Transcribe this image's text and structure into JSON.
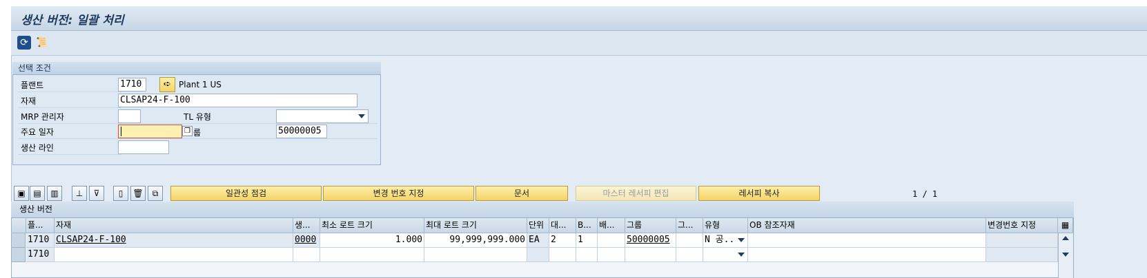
{
  "window": {
    "title": "생산 버전: 일괄 처리"
  },
  "toolbar": {
    "icons": [
      "refresh-icon",
      "scroll-icon"
    ]
  },
  "selection": {
    "title": "선택 조건",
    "plant_label": "플랜트",
    "plant_value": "1710",
    "plant_name": "Plant 1 US",
    "material_label": "자재",
    "material_value": "CLSAP24-F-100",
    "mrp_label": "MRP 관리자",
    "mrp_value": "",
    "tl_type_label": "TL 유형",
    "tl_type_value": "",
    "key_date_label": "주요 일자",
    "key_date_value": "",
    "group_label_partial": "룹",
    "group_value": "50000005",
    "prod_line_label": "생산 라인",
    "prod_line_value": ""
  },
  "grid_toolbar": {
    "buttons": [
      "일관성 점검",
      "변경 번호 지정",
      "문서",
      "마스터 레서피 편집",
      "레서피 복사"
    ],
    "page_indicator": "1 / 1"
  },
  "table": {
    "title": "생산 버전",
    "columns": [
      "플...",
      "자재",
      "생...",
      "최소 로트 크기",
      "최대 로트 크기",
      "단위",
      "대...",
      "B...",
      "배...",
      "그룹",
      "그...",
      "유형",
      "OB 참조자재",
      "변경번호 지정"
    ],
    "rows": [
      {
        "plant": "1710",
        "material": "CLSAP24-F-100",
        "version": "0000",
        "min_lot": "1.000",
        "max_lot": "99,999,999.000",
        "unit": "EA",
        "alt": "2",
        "b": "1",
        "bae": "",
        "group": "50000005",
        "gr": "",
        "type": "N 공..",
        "ob_ref": "",
        "chg_no": ""
      },
      {
        "plant": "1710",
        "material": "",
        "version": "",
        "min_lot": "",
        "max_lot": "",
        "unit": "",
        "alt": "",
        "b": "",
        "bae": "",
        "group": "",
        "gr": "",
        "type": "",
        "ob_ref": "",
        "chg_no": ""
      }
    ]
  }
}
